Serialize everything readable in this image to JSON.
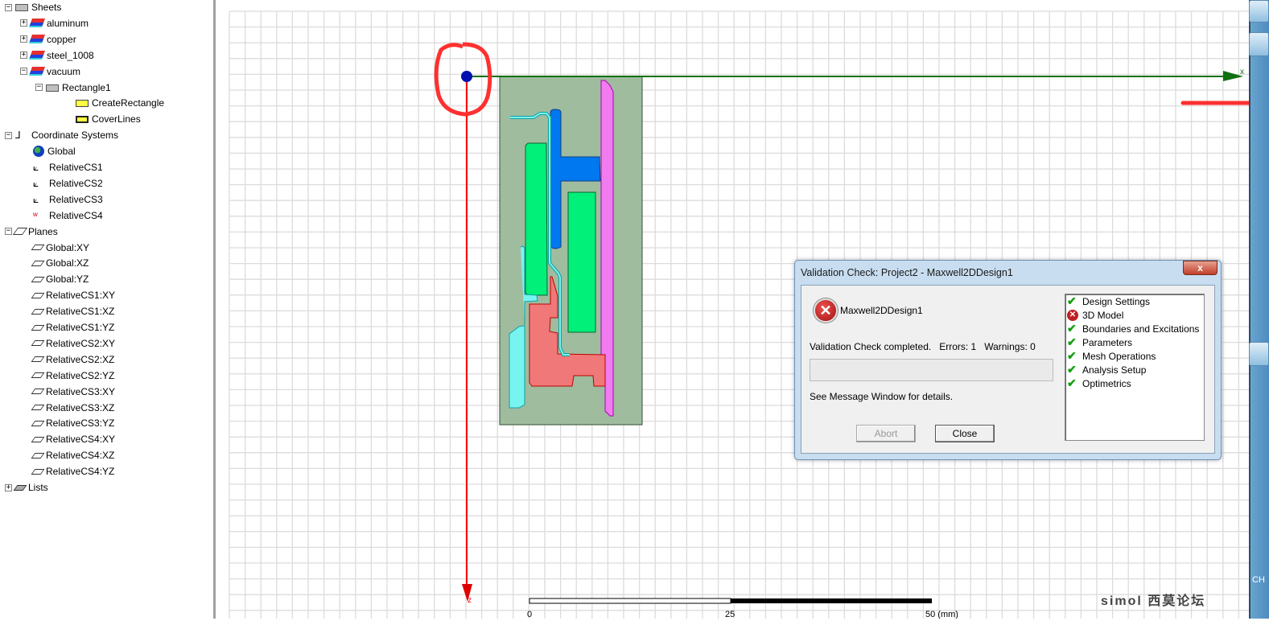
{
  "tree": {
    "items": [
      {
        "label": "Sheets",
        "icon": "sheet-icon",
        "expander": "−",
        "level": 0
      },
      {
        "label": "aluminum",
        "icon": "material-icon",
        "expander": "+",
        "level": 1
      },
      {
        "label": "copper",
        "icon": "material-icon",
        "expander": "+",
        "level": 1
      },
      {
        "label": "steel_1008",
        "icon": "material-icon",
        "expander": "+",
        "level": 1
      },
      {
        "label": "vacuum",
        "icon": "material-icon",
        "expander": "−",
        "level": 1
      },
      {
        "label": "Rectangle1",
        "icon": "sheet-icon",
        "expander": "−",
        "level": 2
      },
      {
        "label": "CreateRectangle",
        "icon": "operation-icon",
        "expander": "",
        "level": 3
      },
      {
        "label": "CoverLines",
        "icon": "cover-icon",
        "expander": "",
        "level": 3
      },
      {
        "label": "Coordinate Systems",
        "icon": "axes-icon",
        "expander": "−",
        "level": 0
      },
      {
        "label": "Global",
        "icon": "globe-icon",
        "expander": "",
        "level": 1
      },
      {
        "label": "RelativeCS1",
        "icon": "relative-cs-icon",
        "expander": "",
        "level": 1
      },
      {
        "label": "RelativeCS2",
        "icon": "relative-cs-icon",
        "expander": "",
        "level": 1
      },
      {
        "label": "RelativeCS3",
        "icon": "relative-cs-icon",
        "expander": "",
        "level": 1
      },
      {
        "label": "RelativeCS4",
        "icon": "working-cs-icon",
        "expander": "",
        "level": 1
      },
      {
        "label": "Planes",
        "icon": "planes-icon",
        "expander": "−",
        "level": 0
      },
      {
        "label": "Global:XY",
        "icon": "plane-icon",
        "expander": "",
        "level": 1
      },
      {
        "label": "Global:XZ",
        "icon": "plane-icon",
        "expander": "",
        "level": 1
      },
      {
        "label": "Global:YZ",
        "icon": "plane-icon",
        "expander": "",
        "level": 1
      },
      {
        "label": "RelativeCS1:XY",
        "icon": "plane-icon",
        "expander": "",
        "level": 1
      },
      {
        "label": "RelativeCS1:XZ",
        "icon": "plane-icon",
        "expander": "",
        "level": 1
      },
      {
        "label": "RelativeCS1:YZ",
        "icon": "plane-icon",
        "expander": "",
        "level": 1
      },
      {
        "label": "RelativeCS2:XY",
        "icon": "plane-icon",
        "expander": "",
        "level": 1
      },
      {
        "label": "RelativeCS2:XZ",
        "icon": "plane-icon",
        "expander": "",
        "level": 1
      },
      {
        "label": "RelativeCS2:YZ",
        "icon": "plane-icon",
        "expander": "",
        "level": 1
      },
      {
        "label": "RelativeCS3:XY",
        "icon": "plane-icon",
        "expander": "",
        "level": 1
      },
      {
        "label": "RelativeCS3:XZ",
        "icon": "plane-icon",
        "expander": "",
        "level": 1
      },
      {
        "label": "RelativeCS3:YZ",
        "icon": "plane-icon",
        "expander": "",
        "level": 1
      },
      {
        "label": "RelativeCS4:XY",
        "icon": "plane-icon",
        "expander": "",
        "level": 1
      },
      {
        "label": "RelativeCS4:XZ",
        "icon": "plane-icon",
        "expander": "",
        "level": 1
      },
      {
        "label": "RelativeCS4:YZ",
        "icon": "plane-icon",
        "expander": "",
        "level": 1
      },
      {
        "label": "Lists",
        "icon": "lists-icon",
        "expander": "+",
        "level": 0
      }
    ]
  },
  "viewport": {
    "x_axis_label": "x",
    "z_axis_label": "z",
    "scale": {
      "ticks": [
        "0",
        "25",
        "50 (mm)"
      ]
    },
    "watermark": "simol 西莫论坛",
    "colors": {
      "x_axis": "#107010",
      "z_axis": "#ff0000",
      "vacuum": "#9fbc9f",
      "steel": "#00f07a",
      "copper_blue": "#0078f0",
      "aluminum": "#f07878",
      "cyan": "#78f4f0",
      "magenta": "#f07cf0",
      "annotation": "#ff3030"
    }
  },
  "dialog": {
    "title": "Validation Check: Project2 - Maxwell2DDesign1",
    "close_glyph": "x",
    "design_name": "Maxwell2DDesign1",
    "status": "Validation Check completed.   Errors: 1   Warnings: 0",
    "progress": 0,
    "hint": "See Message Window for details.",
    "abort_label": "Abort",
    "close_label": "Close",
    "checks": [
      {
        "label": "Design Settings",
        "status": "ok"
      },
      {
        "label": "3D Model",
        "status": "error"
      },
      {
        "label": "Boundaries and Excitations",
        "status": "ok"
      },
      {
        "label": "Parameters",
        "status": "ok"
      },
      {
        "label": "Mesh Operations",
        "status": "ok"
      },
      {
        "label": "Analysis Setup",
        "status": "ok"
      },
      {
        "label": "Optimetrics",
        "status": "ok"
      }
    ]
  },
  "taskbar": {
    "text": "CH"
  }
}
